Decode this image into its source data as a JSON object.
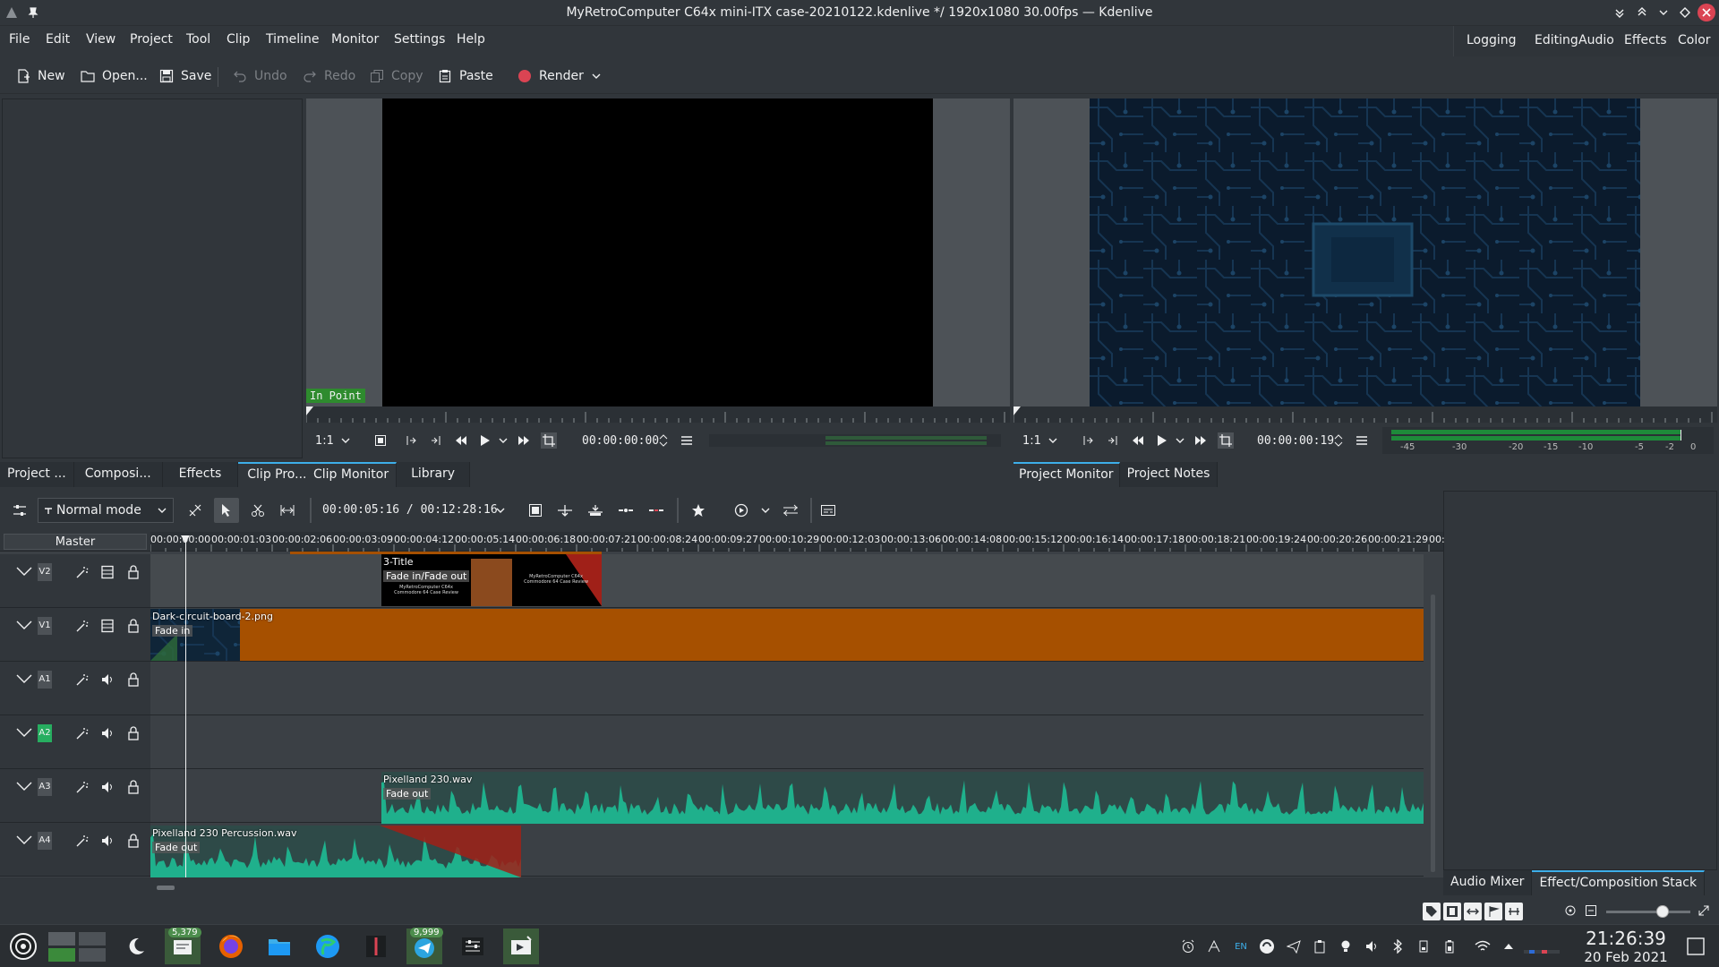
{
  "window": {
    "title": "MyRetroComputer C64x mini-ITX case-20210122.kdenlive */ 1920x1080 30.00fps — Kdenlive"
  },
  "menu": [
    "File",
    "Edit",
    "View",
    "Project",
    "Tool",
    "Clip",
    "Timeline",
    "Monitor",
    "Settings",
    "Help"
  ],
  "workspaces": [
    "Logging",
    "Editing",
    "Audio",
    "Effects",
    "Color"
  ],
  "toolbar": {
    "new": "New",
    "open": "Open...",
    "save": "Save",
    "undo": "Undo",
    "redo": "Redo",
    "copy": "Copy",
    "paste": "Paste",
    "render": "Render"
  },
  "left_tabs": [
    "Project ...",
    "Composi...",
    "Effects",
    "Clip Pro..."
  ],
  "clip_monitor": {
    "overlay": "In Point",
    "zoom": "1:1",
    "timecode": "00:00:00:00",
    "tabs": [
      "Clip Monitor",
      "Library"
    ]
  },
  "project_monitor": {
    "zoom": "1:1",
    "timecode": "00:00:00:19",
    "tabs": [
      "Project Monitor",
      "Project Notes"
    ],
    "meter_scale": [
      "-45",
      "-30",
      "-20",
      "-15",
      "-10",
      "-5",
      "-2",
      "0"
    ]
  },
  "timeline": {
    "mode": "Normal mode",
    "position": "00:00:05:16 / 00:12:28:16",
    "master": "Master",
    "ruler": [
      "00:00:00:00",
      "00:00:01:03",
      "00:00:02:06",
      "00:00:03:09",
      "00:00:04:12",
      "00:00:05:14",
      "00:00:06:18",
      "00:00:07:21",
      "00:00:08:24",
      "00:00:09:27",
      "00:00:10:29",
      "00:00:12:03",
      "00:00:13:06",
      "00:00:14:08",
      "00:00:15:12",
      "00:00:16:14",
      "00:00:17:18",
      "00:00:18:21",
      "00:00:19:24",
      "00:00:20:26",
      "00:00:21:29",
      "00:"
    ],
    "tracks": [
      {
        "name": "V2",
        "kind": "video"
      },
      {
        "name": "V1",
        "kind": "video"
      },
      {
        "name": "A1",
        "kind": "audio"
      },
      {
        "name": "A2",
        "kind": "audio",
        "active": true
      },
      {
        "name": "A3",
        "kind": "audio"
      },
      {
        "name": "A4",
        "kind": "audio"
      }
    ],
    "clips": {
      "title_clip": "3-Title",
      "title_fade": "Fade in/Fade out",
      "title_thumb_text": "MyRetroComputer C64x Commodore 64 Case Review",
      "bg_clip": "Dark-circuit-board-2.png",
      "bg_fade": "Fade in",
      "audio_a3": "Pixelland 230.wav",
      "audio_a3_fade": "Fade out",
      "audio_a4": "Pixelland 230 Percussion.wav",
      "audio_a4_fade": "Fade out"
    }
  },
  "right_tabs": [
    "Audio Mixer",
    "Effect/Composition Stack"
  ],
  "taskbar": {
    "badge1": "5,379",
    "badge2": "9,999",
    "lang": "EN",
    "time": "21:26:39",
    "date": "20 Feb 2021"
  },
  "colors": {
    "accent": "#3daee9",
    "video_clip": "#a65000",
    "audio_wave": "#1fb08c",
    "fade_red": "#a02018",
    "in_point_bg": "#2e8b2e"
  }
}
